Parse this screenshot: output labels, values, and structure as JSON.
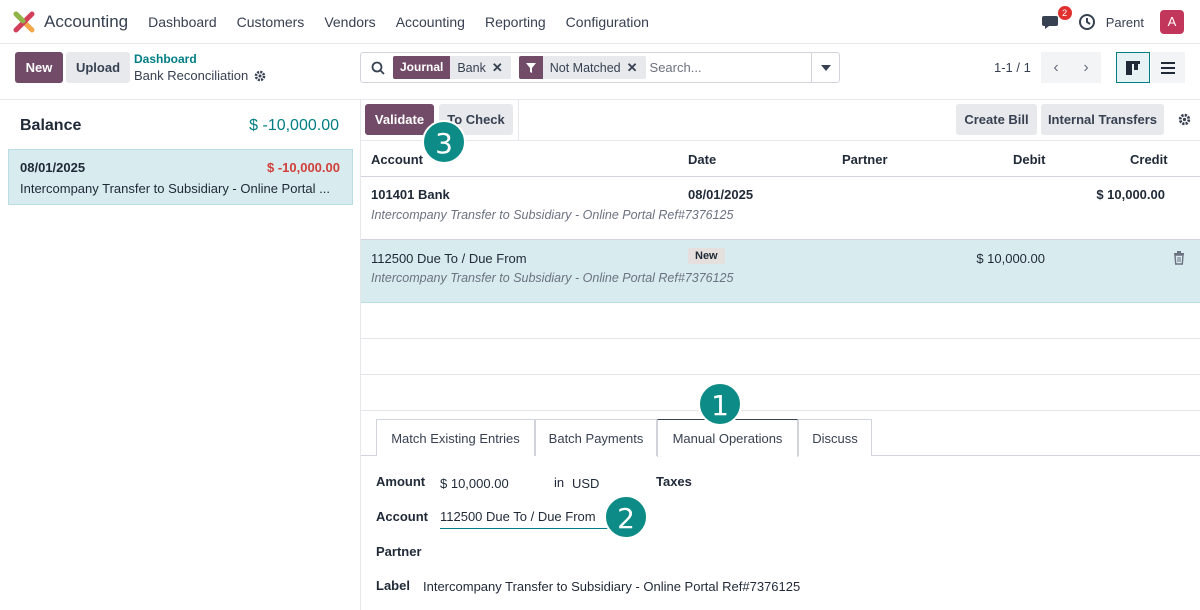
{
  "navbar": {
    "app_name": "Accounting",
    "menu": [
      "Dashboard",
      "Customers",
      "Vendors",
      "Accounting",
      "Reporting",
      "Configuration"
    ],
    "chat_count": "2",
    "user_name": "Parent",
    "avatar_letter": "A"
  },
  "control": {
    "new_label": "New",
    "upload_label": "Upload",
    "breadcrumb_parent": "Dashboard",
    "breadcrumb_current": "Bank Reconciliation",
    "search": {
      "facets": [
        {
          "label": "Journal",
          "value": "Bank"
        },
        {
          "label": "filter-icon",
          "value": "Not Matched"
        }
      ],
      "placeholder": "Search..."
    },
    "pager": "1-1 / 1"
  },
  "left": {
    "balance_label": "Balance",
    "balance_value": "$ -10,000.00",
    "statement": {
      "date": "08/01/2025",
      "amount": "$ -10,000.00",
      "label": "Intercompany Transfer to Subsidiary - Online Portal ..."
    }
  },
  "right": {
    "validate_label": "Validate",
    "tocheck_label": "To Check",
    "createbill_label": "Create Bill",
    "transfers_label": "Internal Transfers",
    "columns": [
      "Account",
      "Date",
      "Partner",
      "Debit",
      "Credit"
    ],
    "rows": [
      {
        "account": "101401 Bank",
        "date": "08/01/2025",
        "credit": "$ 10,000.00",
        "label": "Intercompany Transfer to Subsidiary - Online Portal Ref#7376125"
      },
      {
        "account": "112500 Due To / Due From",
        "badge": "New",
        "debit": "$ 10,000.00",
        "label": "Intercompany Transfer to Subsidiary - Online Portal Ref#7376125"
      }
    ],
    "tabs": [
      "Match Existing Entries",
      "Batch Payments",
      "Manual Operations",
      "Discuss"
    ],
    "form": {
      "amount_label": "Amount",
      "amount_value": "$ 10,000.00",
      "in_label": "in",
      "currency": "USD",
      "taxes_label": "Taxes",
      "account_label": "Account",
      "account_value": "112500 Due To / Due From",
      "partner_label": "Partner",
      "label_label": "Label",
      "label_value": "Intercompany Transfer to Subsidiary - Online Portal Ref#7376125"
    }
  },
  "steps": [
    "1",
    "2",
    "3"
  ],
  "colors": {
    "brand": "#714b67",
    "teal": "#017e84",
    "negative": "#d23f3a",
    "selected_row": "#d8ebee",
    "step_marker": "#0d8b86"
  }
}
